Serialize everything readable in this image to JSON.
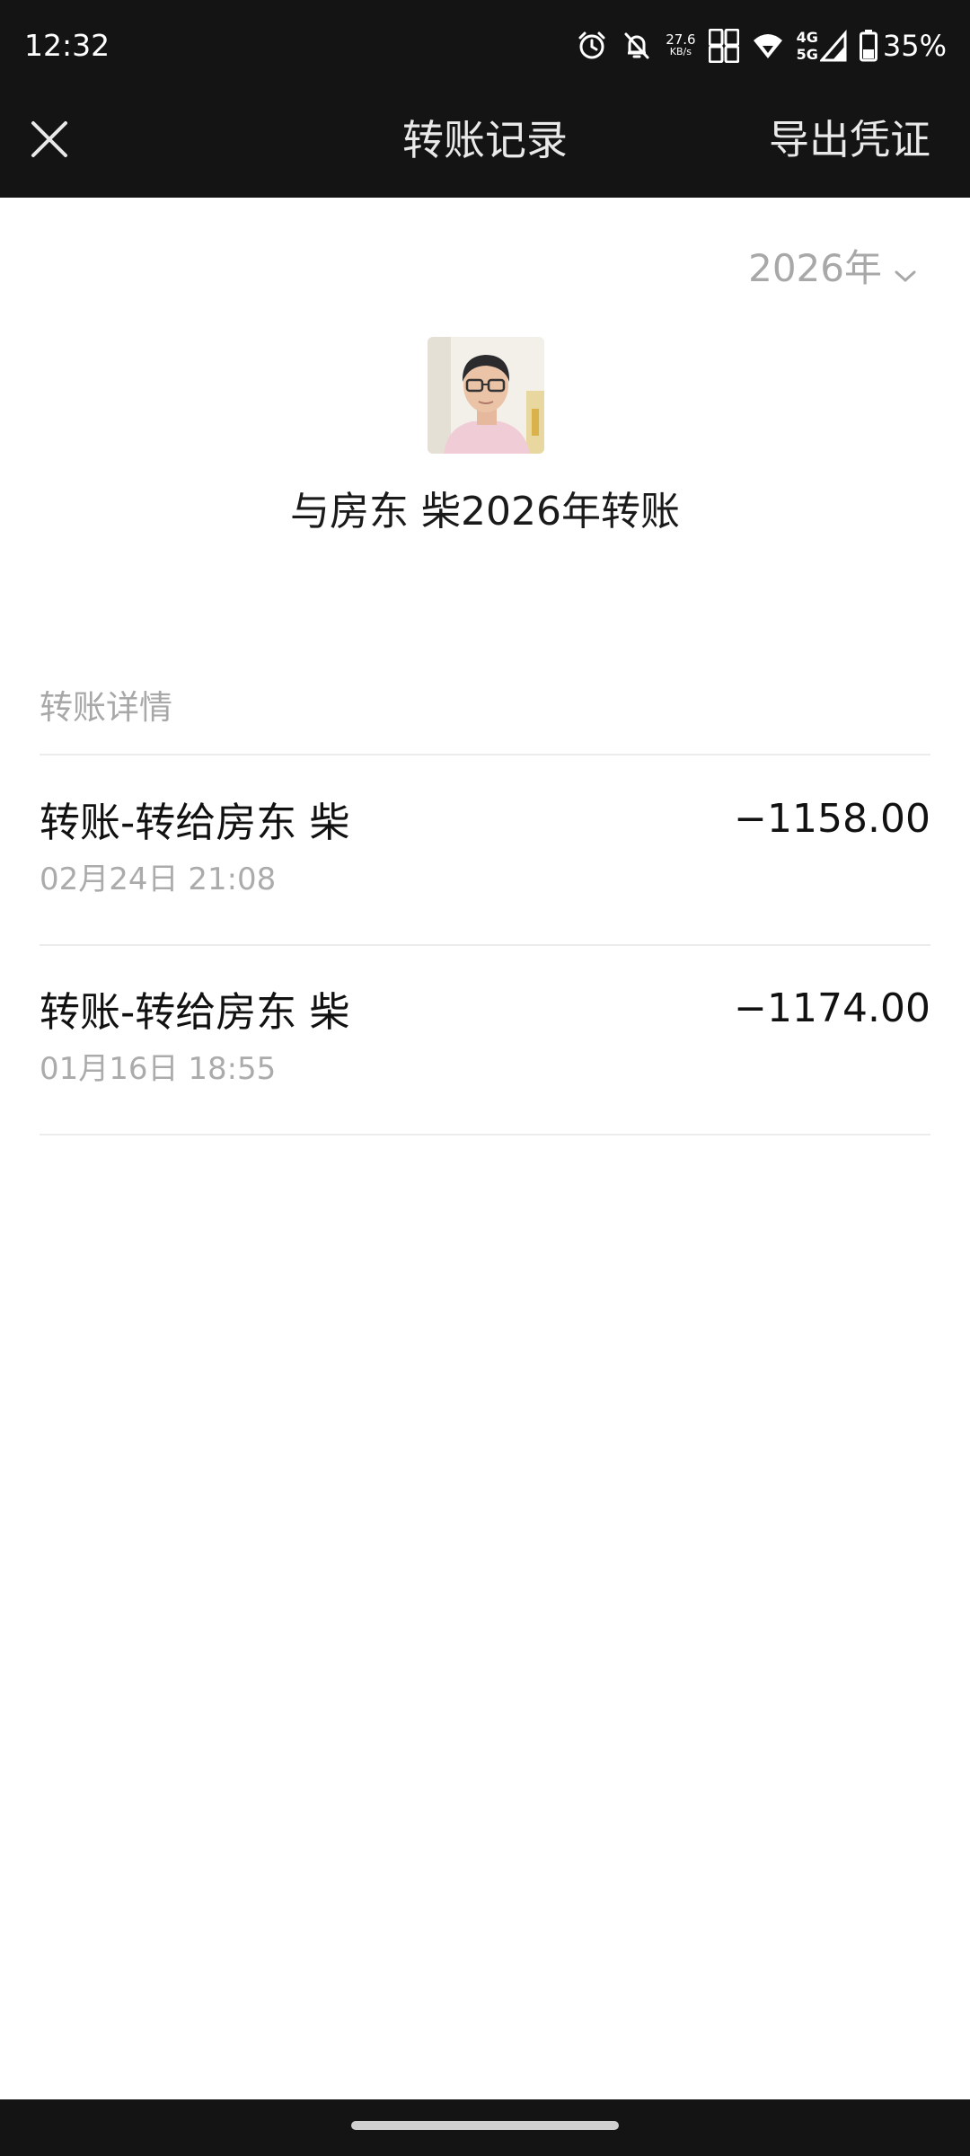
{
  "status_bar": {
    "time": "12:32",
    "net_speed_value": "27.6",
    "net_speed_unit": "KB/s",
    "network_gen_top": "4G",
    "network_gen_bottom": "5G",
    "battery_percent": "35%",
    "icons": [
      "alarm-icon",
      "mute-notification-icon",
      "net-speed",
      "hd-volte-icon",
      "wifi-icon",
      "signal-icon",
      "battery-icon"
    ]
  },
  "title_bar": {
    "title": "转账记录",
    "action_label": "导出凭证",
    "close_icon": "close-icon"
  },
  "filter": {
    "year_label": "2026年",
    "icon": "chevron-down-icon"
  },
  "contact": {
    "headline": "与房东 柴2026年转账"
  },
  "section": {
    "label": "转账详情"
  },
  "transactions": [
    {
      "title": "转账-转给房东 柴",
      "time": "02月24日 21:08",
      "amount": "−1158.00"
    },
    {
      "title": "转账-转给房东 柴",
      "time": "01月16日 18:55",
      "amount": "−1174.00"
    }
  ],
  "colors": {
    "bar_bg": "#141414",
    "page_bg": "#ffffff",
    "muted_text": "#a8a8a8",
    "primary_text": "#111111"
  }
}
